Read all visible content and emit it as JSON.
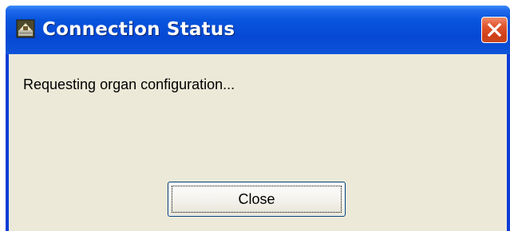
{
  "window": {
    "title": "Connection Status",
    "icon": "app-icon"
  },
  "title_controls": {
    "close_icon": "close-icon"
  },
  "dialog": {
    "message": "Requesting organ configuration...",
    "close_label": "Close"
  },
  "colors": {
    "titlebar": "#0855dd",
    "frame": "#0a3ed6",
    "client_bg": "#ece9d8",
    "close_button_red": "#cf3f17"
  }
}
